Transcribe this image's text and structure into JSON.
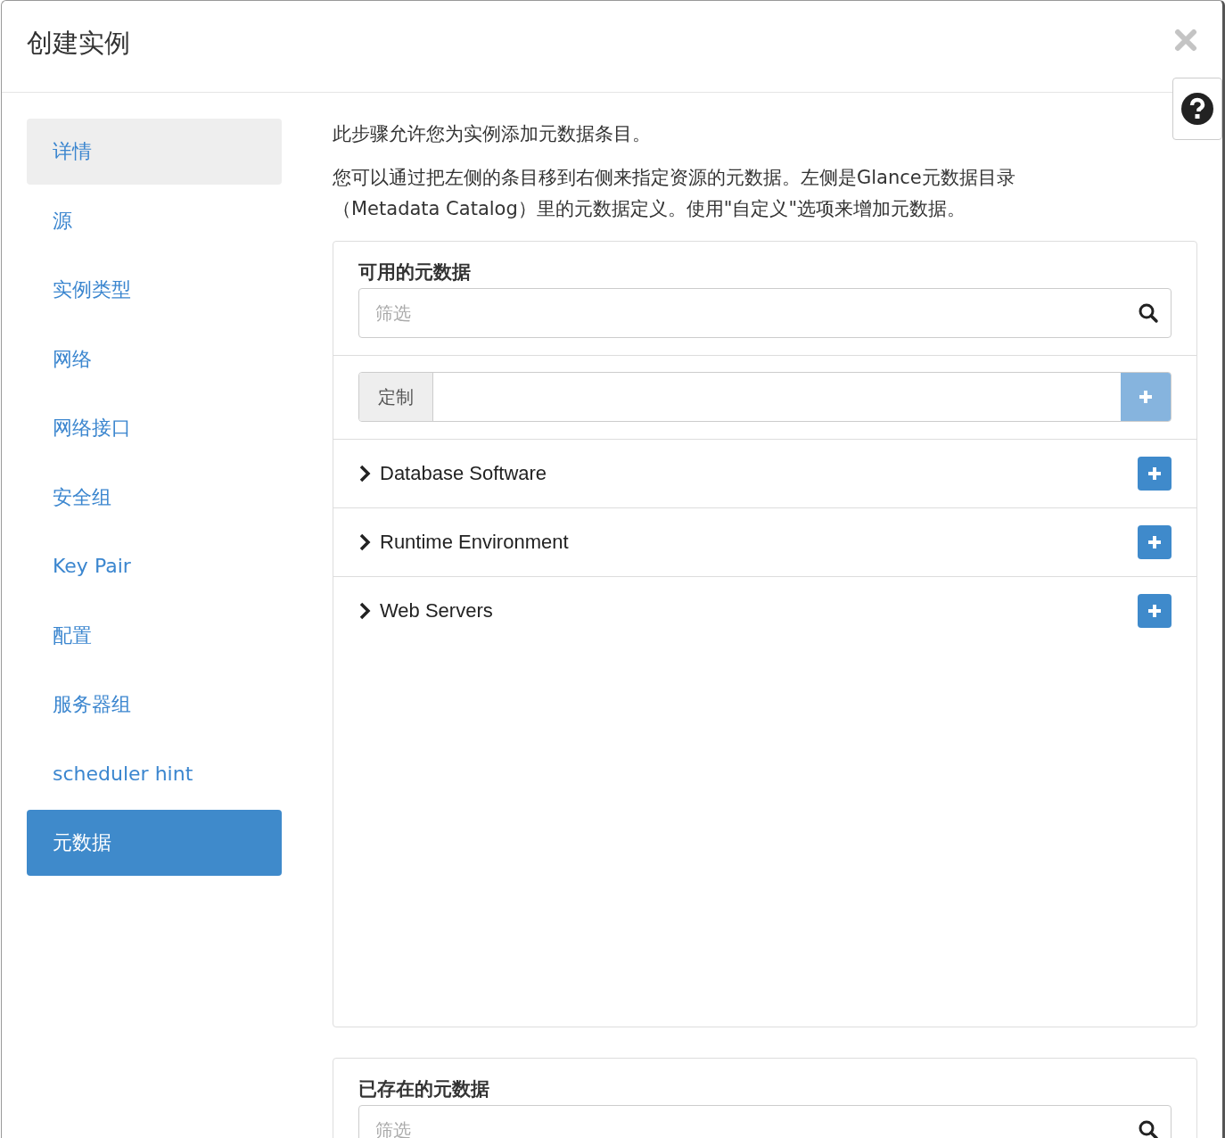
{
  "window": {
    "title": "创建实例"
  },
  "sidebar": {
    "items": [
      {
        "label": "详情",
        "selected": false,
        "hovered": true
      },
      {
        "label": "源",
        "selected": false,
        "hovered": false
      },
      {
        "label": "实例类型",
        "selected": false,
        "hovered": false
      },
      {
        "label": "网络",
        "selected": false,
        "hovered": false
      },
      {
        "label": "网络接口",
        "selected": false,
        "hovered": false
      },
      {
        "label": "安全组",
        "selected": false,
        "hovered": false
      },
      {
        "label": "Key Pair",
        "selected": false,
        "hovered": false
      },
      {
        "label": "配置",
        "selected": false,
        "hovered": false
      },
      {
        "label": "服务器组",
        "selected": false,
        "hovered": false
      },
      {
        "label": "scheduler hint",
        "selected": false,
        "hovered": false
      },
      {
        "label": "元数据",
        "selected": true,
        "hovered": false
      }
    ]
  },
  "intro": [
    "此步骤允许您为实例添加元数据条目。",
    "您可以通过把左侧的条目移到右侧来指定资源的元数据。左侧是Glance元数据目录（Metadata Catalog）里的元数据定义。使用\"自定义\"选项来增加元数据。"
  ],
  "available": {
    "title": "可用的元数据",
    "filter": {
      "placeholder": "筛选"
    },
    "custom": {
      "label": "定制",
      "add_disabled": true
    },
    "items": [
      {
        "label": "Database Software"
      },
      {
        "label": "Runtime Environment"
      },
      {
        "label": "Web Servers"
      }
    ]
  },
  "existing": {
    "title": "已存在的元数据",
    "filter": {
      "placeholder": "筛选"
    }
  }
}
